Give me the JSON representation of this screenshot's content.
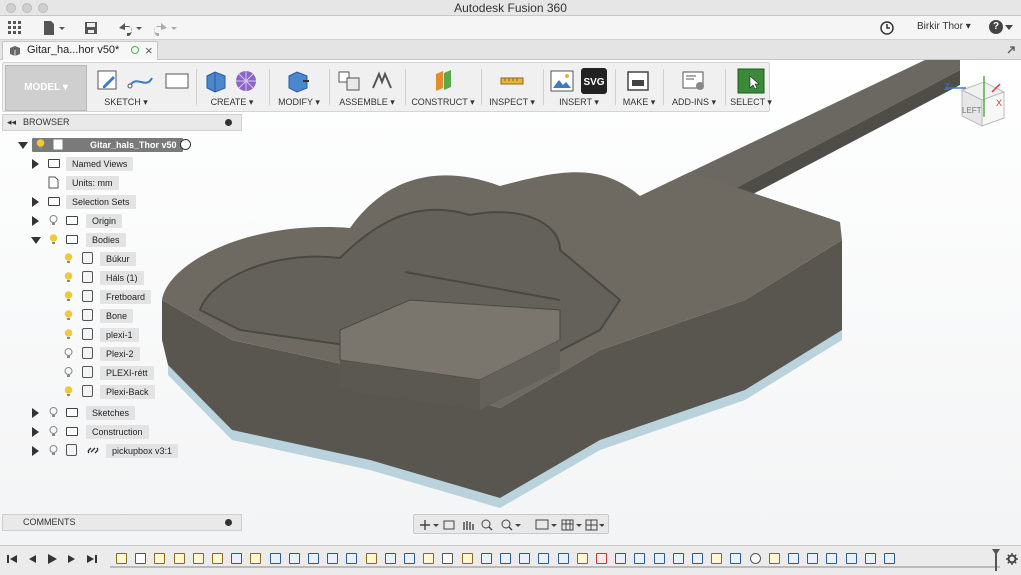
{
  "window": {
    "title": "Autodesk Fusion 360"
  },
  "appbar": {
    "user": "Birkir Thor ▾",
    "help": "?"
  },
  "tab": {
    "label": "Gitar_ha...hor v50*",
    "close": "×"
  },
  "toolbar": {
    "mode": "MODEL ▾",
    "groups": [
      {
        "label": "SKETCH ▾"
      },
      {
        "label": "CREATE ▾"
      },
      {
        "label": "MODIFY ▾"
      },
      {
        "label": "ASSEMBLE ▾"
      },
      {
        "label": "CONSTRUCT ▾"
      },
      {
        "label": "INSPECT ▾"
      },
      {
        "label": "INSERT ▾"
      },
      {
        "label": "MAKE ▾"
      },
      {
        "label": "ADD-INS ▾"
      },
      {
        "label": "SELECT ▾"
      }
    ],
    "svg_badge": "SVG"
  },
  "browser": {
    "title": "BROWSER",
    "root": "Gitar_hals_Thor v50",
    "items": [
      {
        "label": "Named Views"
      },
      {
        "label": "Units: mm"
      },
      {
        "label": "Selection Sets"
      },
      {
        "label": "Origin"
      },
      {
        "label": "Bodies"
      },
      {
        "label": "Búkur"
      },
      {
        "label": "Háls (1)"
      },
      {
        "label": "Fretboard"
      },
      {
        "label": "Bone"
      },
      {
        "label": "plexi-1"
      },
      {
        "label": "Plexi-2"
      },
      {
        "label": "PLEXI-rétt"
      },
      {
        "label": "Plexi-Back"
      },
      {
        "label": "Sketches"
      },
      {
        "label": "Construction"
      },
      {
        "label": "pickupbox v3:1"
      }
    ]
  },
  "comments": {
    "title": "COMMENTS"
  },
  "viewcube": {
    "face": "LEFT",
    "axis_z": "Z",
    "axis_x": "X"
  },
  "colors": {
    "accent_blue": "#1f6fb2",
    "body_top": "#6e6a62",
    "body_side": "#595650",
    "plexi": "#b9d2dc",
    "bulb": "#f0c93a"
  },
  "icons": {
    "timeline_controls": [
      "skip-start-icon",
      "step-back-icon",
      "play-icon",
      "step-forward-icon",
      "skip-end-icon"
    ],
    "settings": "gear-icon"
  }
}
